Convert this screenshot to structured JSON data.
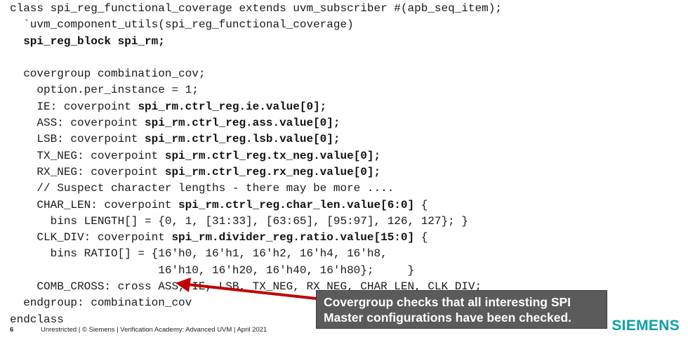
{
  "code": {
    "lines": [
      [
        {
          "t": "class spi_reg_functional_coverage extends uvm_subscriber #(apb_seq_item);",
          "b": false
        }
      ],
      [
        {
          "t": "  `uvm_component_utils(spi_reg_functional_coverage)",
          "b": false
        }
      ],
      [
        {
          "t": "  ",
          "b": false
        },
        {
          "t": "spi_reg_block spi_rm;",
          "b": true
        }
      ],
      [
        {
          "t": "",
          "b": false
        }
      ],
      [
        {
          "t": "  covergroup combination_cov;",
          "b": false
        }
      ],
      [
        {
          "t": "    option.per_instance = 1;",
          "b": false
        }
      ],
      [
        {
          "t": "    IE: coverpoint ",
          "b": false
        },
        {
          "t": "spi_rm.ctrl_reg.ie.value[0];",
          "b": true
        }
      ],
      [
        {
          "t": "    ASS: coverpoint ",
          "b": false
        },
        {
          "t": "spi_rm.ctrl_reg.ass.value[0];",
          "b": true
        }
      ],
      [
        {
          "t": "    LSB: coverpoint ",
          "b": false
        },
        {
          "t": "spi_rm.ctrl_reg.lsb.value[0];",
          "b": true
        }
      ],
      [
        {
          "t": "    TX_NEG: coverpoint ",
          "b": false
        },
        {
          "t": "spi_rm.ctrl_reg.tx_neg.value[0];",
          "b": true
        }
      ],
      [
        {
          "t": "    RX_NEG: coverpoint ",
          "b": false
        },
        {
          "t": "spi_rm.ctrl_reg.rx_neg.value[0];",
          "b": true
        }
      ],
      [
        {
          "t": "    // Suspect character lengths - there may be more ....",
          "b": false
        }
      ],
      [
        {
          "t": "    CHAR_LEN: coverpoint ",
          "b": false
        },
        {
          "t": "spi_rm.ctrl_reg.char_len.value[6:0]",
          "b": true
        },
        {
          "t": " {",
          "b": false
        }
      ],
      [
        {
          "t": "      bins LENGTH[] = {0, 1, [31:33], [63:65], [95:97], 126, 127}; }",
          "b": false
        }
      ],
      [
        {
          "t": "    CLK_DIV: coverpoint ",
          "b": false
        },
        {
          "t": "spi_rm.divider_reg.ratio.value[15:0]",
          "b": true
        },
        {
          "t": " {",
          "b": false
        }
      ],
      [
        {
          "t": "      bins RATIO[] = {16'h0, 16'h1, 16'h2, 16'h4, 16'h8,",
          "b": false
        }
      ],
      [
        {
          "t": "                      16'h10, 16'h20, 16'h40, 16'h80};     }",
          "b": false
        }
      ],
      [
        {
          "t": "    COMB_CROSS: cross ASS, IE, LSB, TX_NEG, RX_NEG, CHAR_LEN, CLK_DIV;",
          "b": false
        }
      ],
      [
        {
          "t": "  endgroup: combination_cov",
          "b": false
        }
      ],
      [
        {
          "t": "endclass",
          "b": false
        }
      ]
    ]
  },
  "callout": {
    "line1": "Covergroup checks that all interesting SPI",
    "line2": "Master configurations have been checked."
  },
  "footer": {
    "page_number": "6",
    "text": "Unrestricted | © Siemens | Verification Academy: Advanced UVM | April 2021"
  },
  "logo": {
    "text": "SIEMENS"
  },
  "colors": {
    "arrow": "#c00000",
    "callout_bg": "#5b5b5b",
    "logo": "#0a9fa8"
  }
}
